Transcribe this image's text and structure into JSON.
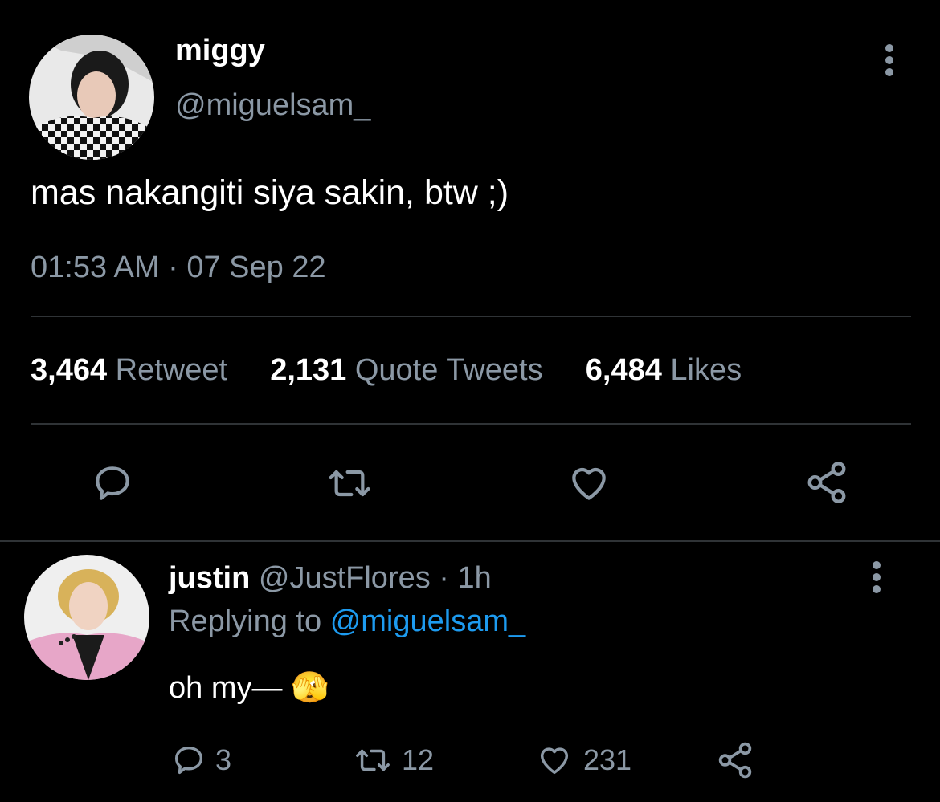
{
  "tweet": {
    "display_name": "miggy",
    "handle": "@miguelsam_",
    "text": "mas nakangiti siya sakin, btw ;)",
    "timestamp": "01:53 AM · 07 Sep 22",
    "stats": {
      "retweets_count": "3,464",
      "retweets_label": "Retweet",
      "quotes_count": "2,131",
      "quotes_label": "Quote Tweets",
      "likes_count": "6,484",
      "likes_label": "Likes"
    },
    "icons": [
      "reply-icon",
      "retweet-icon",
      "like-icon",
      "share-icon",
      "more-options-icon"
    ]
  },
  "reply": {
    "display_name": "justin",
    "handle_meta": "@JustFlores · 1h",
    "replying_prefix": "Replying to",
    "replying_handle": "@miguelsam_",
    "text": "oh my— 🫣",
    "counts": {
      "reply": "3",
      "retweet": "12",
      "like": "231"
    }
  },
  "colors": {
    "background": "#000000",
    "text": "#e7e9ea",
    "muted": "#8b98a5",
    "link": "#1d9bf0",
    "divider": "#2f3336"
  }
}
